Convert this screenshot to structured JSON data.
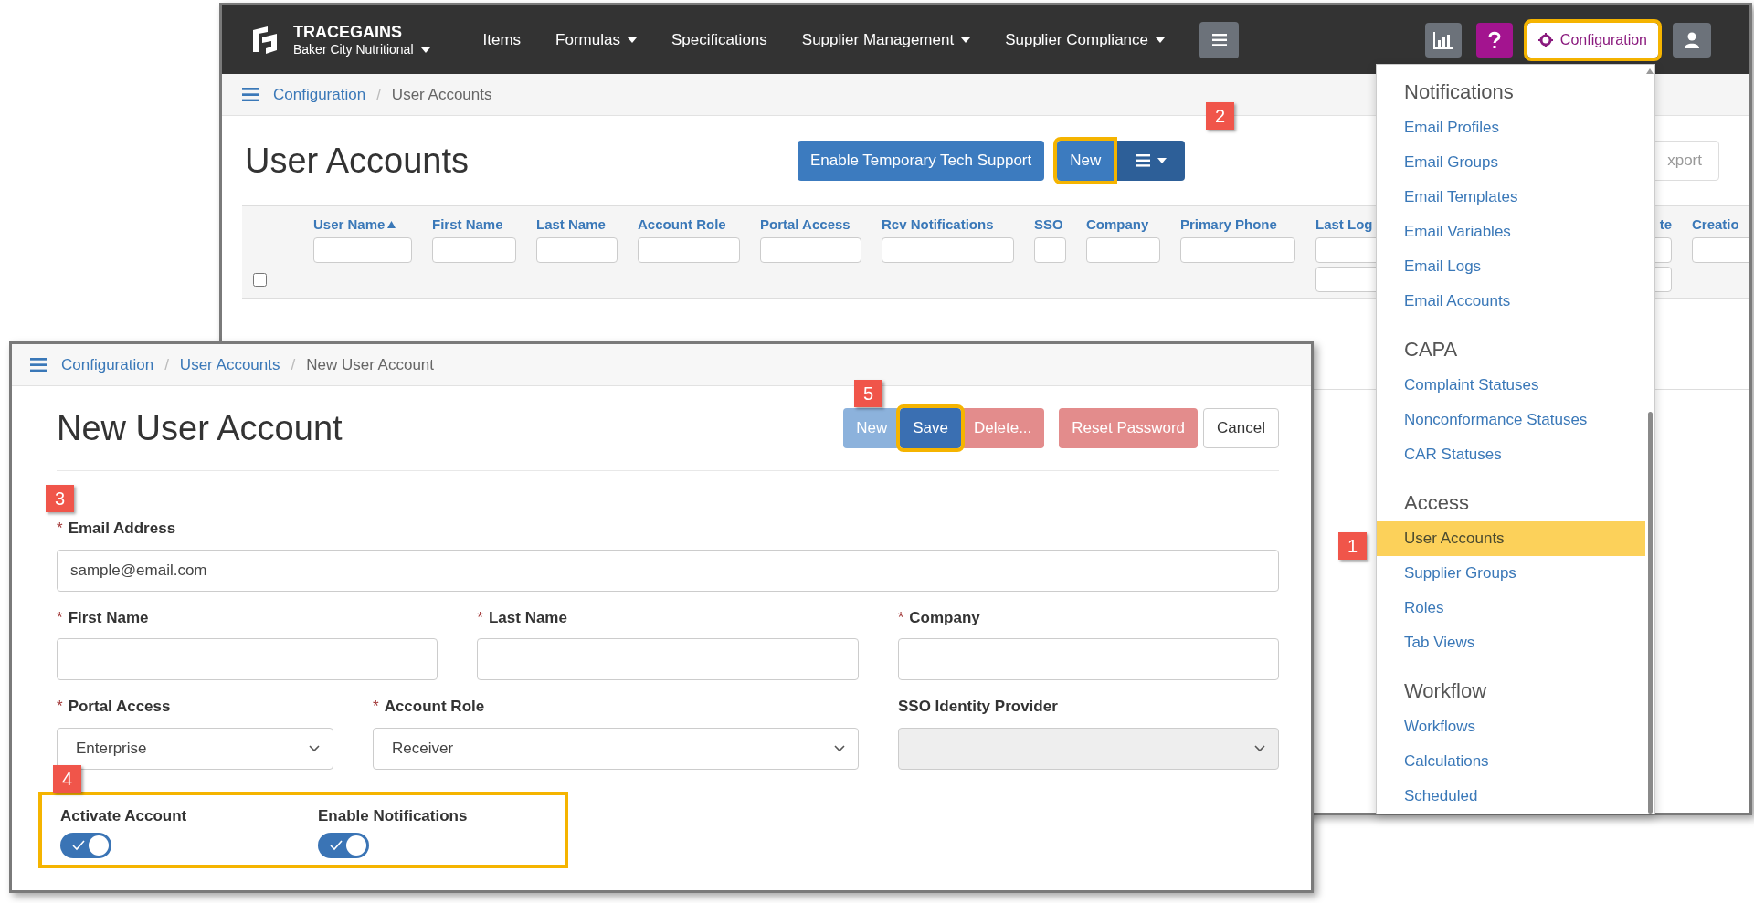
{
  "back_window": {
    "brand": {
      "name": "TRACEGAINS",
      "account": "Baker City Nutritional"
    },
    "nav": [
      {
        "label": "Items",
        "dropdown": false
      },
      {
        "label": "Formulas",
        "dropdown": true
      },
      {
        "label": "Specifications",
        "dropdown": false
      },
      {
        "label": "Supplier Management",
        "dropdown": true
      },
      {
        "label": "Supplier Compliance",
        "dropdown": true
      }
    ],
    "config_button": {
      "label": "Configuration",
      "highlighted": true
    },
    "breadcrumb": [
      "Configuration",
      "User Accounts"
    ],
    "breadcrumb_separators": [
      "/"
    ],
    "select_all_checked": false,
    "title": "User Accounts",
    "actions": [
      {
        "label": "Enable Temporary Tech Support",
        "highlighted": false
      },
      {
        "label": "New",
        "highlighted": true
      }
    ],
    "export_label": "xport",
    "columns": [
      {
        "label": "User Name",
        "sorted": true,
        "kind": "text"
      },
      {
        "label": "First Name",
        "sorted": false,
        "kind": "text"
      },
      {
        "label": "Last Name",
        "sorted": false,
        "kind": "text"
      },
      {
        "label": "Account Role",
        "sorted": false,
        "kind": "text"
      },
      {
        "label": "Portal Access",
        "sorted": false,
        "kind": "text"
      },
      {
        "label": "Rcv Notifications",
        "sorted": false,
        "kind": "text"
      },
      {
        "label": "SSO",
        "sorted": false,
        "kind": "text"
      },
      {
        "label": "Company",
        "sorted": false,
        "kind": "text"
      },
      {
        "label": "Primary Phone",
        "sorted": false,
        "kind": "text"
      },
      {
        "label": "Last Log",
        "sorted": false,
        "kind": "range"
      },
      {
        "label": "te",
        "sorted": false,
        "kind": "range"
      },
      {
        "label": "Creatio",
        "sorted": false,
        "kind": "text"
      }
    ]
  },
  "config_menu": {
    "sections": [
      {
        "heading": "Notifications",
        "items": [
          {
            "label": "Email Profiles",
            "selected": false
          },
          {
            "label": "Email Groups",
            "selected": false
          },
          {
            "label": "Email Templates",
            "selected": false
          },
          {
            "label": "Email Variables",
            "selected": false
          },
          {
            "label": "Email Logs",
            "selected": false
          },
          {
            "label": "Email Accounts",
            "selected": false
          }
        ]
      },
      {
        "heading": "CAPA",
        "items": [
          {
            "label": "Complaint Statuses",
            "selected": false
          },
          {
            "label": "Nonconformance Statuses",
            "selected": false
          },
          {
            "label": "CAR Statuses",
            "selected": false
          }
        ]
      },
      {
        "heading": "Access",
        "items": [
          {
            "label": "User Accounts",
            "selected": true
          },
          {
            "label": "Supplier Groups",
            "selected": false
          },
          {
            "label": "Roles",
            "selected": false
          },
          {
            "label": "Tab Views",
            "selected": false
          }
        ]
      },
      {
        "heading": "Workflow",
        "items": [
          {
            "label": "Workflows",
            "selected": false
          },
          {
            "label": "Calculations",
            "selected": false
          },
          {
            "label": "Scheduled",
            "selected": false
          }
        ]
      }
    ]
  },
  "front_window": {
    "breadcrumb": [
      "Configuration",
      "User Accounts",
      "New User Account"
    ],
    "breadcrumb_separators": [
      "/",
      "/"
    ],
    "required_mark": "*",
    "title": "New User Account",
    "buttons": [
      {
        "label": "New",
        "kind": "faded",
        "highlighted": false
      },
      {
        "label": "Save",
        "kind": "primary",
        "highlighted": true
      },
      {
        "label": "Delete...",
        "kind": "danger",
        "highlighted": false
      },
      {
        "label": "Reset Password",
        "kind": "danger",
        "highlighted": false
      },
      {
        "label": "Cancel",
        "kind": "default",
        "highlighted": false
      }
    ],
    "rows": [
      [
        {
          "label": "Email Address",
          "required": true,
          "kind": "text",
          "value": "sample@email.com",
          "disabled": false
        }
      ],
      [
        {
          "label": "First Name",
          "required": true,
          "kind": "text",
          "disabled": false
        },
        {
          "label": "Last Name",
          "required": true,
          "kind": "text",
          "disabled": false
        },
        {
          "label": "Company",
          "required": true,
          "kind": "text",
          "disabled": false
        }
      ],
      [
        {
          "label": "Portal Access",
          "required": true,
          "kind": "select",
          "value": "Enterprise",
          "disabled": false
        },
        {
          "label": "Account Role",
          "required": true,
          "kind": "select",
          "value": "Receiver",
          "disabled": false
        },
        {
          "label": "SSO Identity Provider",
          "required": false,
          "kind": "select",
          "disabled": true
        }
      ]
    ],
    "toggles": [
      {
        "label": "Activate Account",
        "on": true
      },
      {
        "label": "Enable Notifications",
        "on": true
      }
    ],
    "toggles_highlighted": true
  },
  "callouts": [
    "1",
    "2",
    "3",
    "4",
    "5"
  ]
}
